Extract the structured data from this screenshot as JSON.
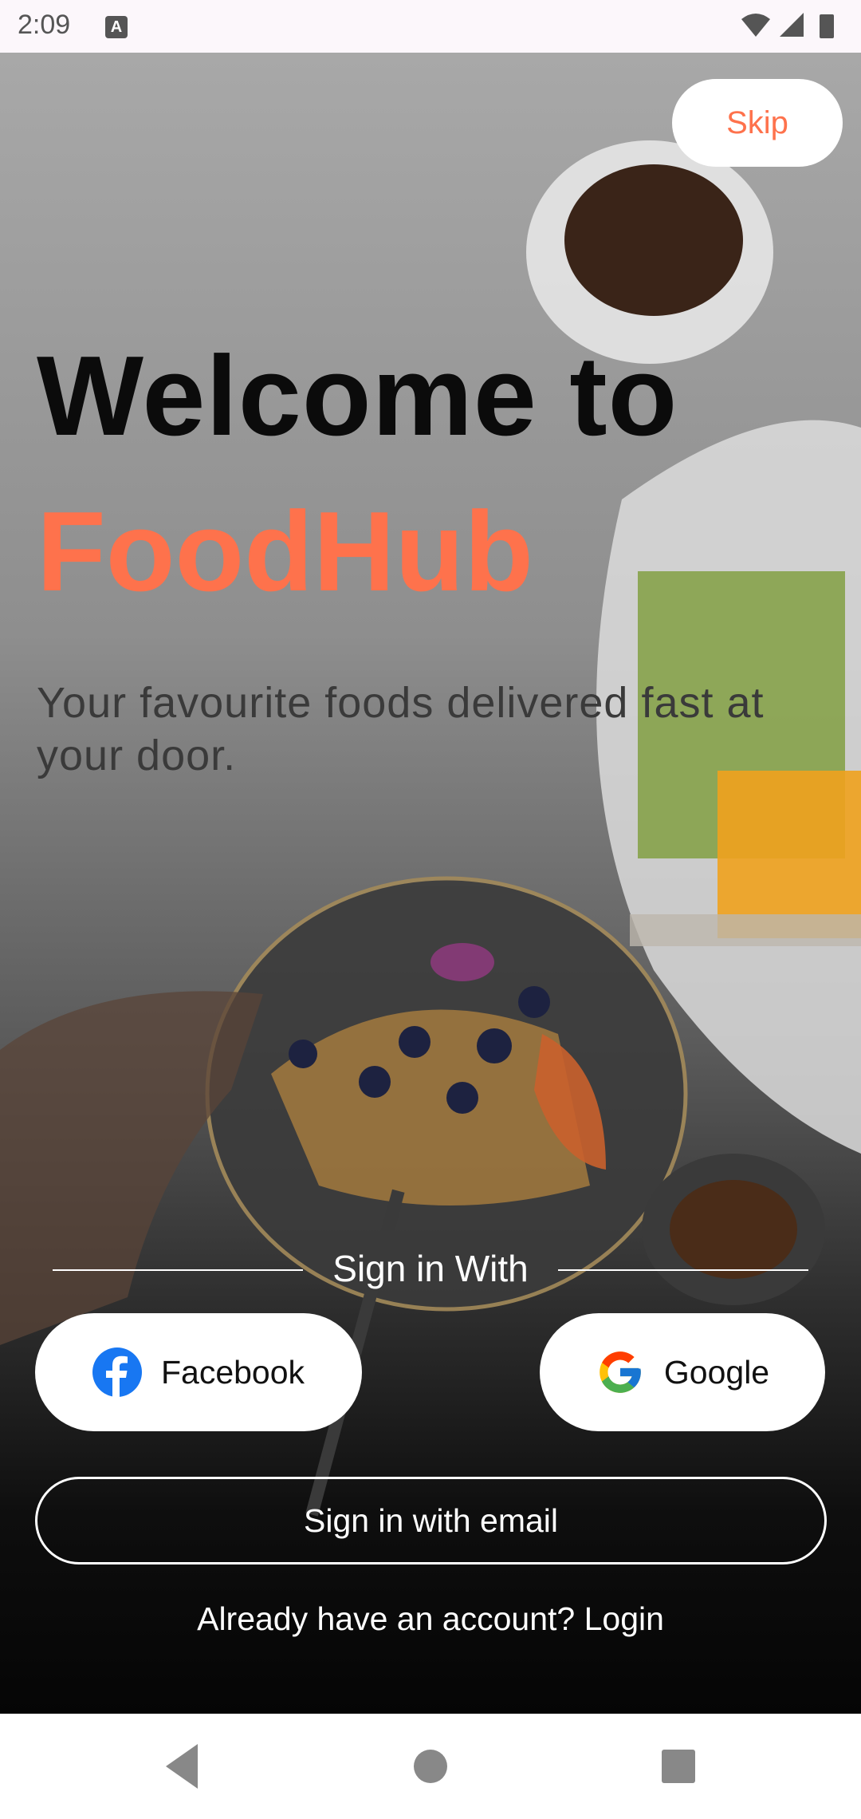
{
  "status_bar": {
    "time": "2:09",
    "keyboard_icon": "A"
  },
  "hero": {
    "skip_label": "Skip",
    "welcome_text": "Welcome to",
    "brand_name": "FoodHub",
    "tagline": "Your favourite foods delivered fast at your door."
  },
  "sign_in": {
    "divider_label": "Sign in With",
    "facebook_label": "Facebook",
    "google_label": "Google",
    "email_label": "Sign in with email",
    "login_prompt": "Already have an account? Login"
  },
  "colors": {
    "accent": "#fe724c",
    "facebook_blue": "#1877f2"
  }
}
